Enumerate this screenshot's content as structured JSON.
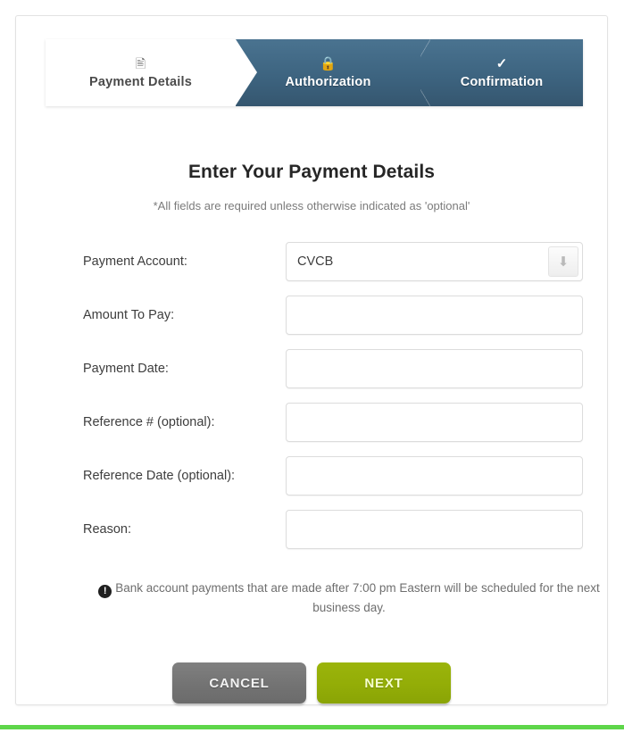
{
  "stepper": {
    "steps": [
      {
        "label": "Payment Details",
        "icon": "document-icon",
        "state": "active"
      },
      {
        "label": "Authorization",
        "icon": "lock-icon",
        "state": "inactive"
      },
      {
        "label": "Confirmation",
        "icon": "check-icon",
        "state": "inactive"
      }
    ]
  },
  "form": {
    "title": "Enter Your Payment Details",
    "subtitle": "*All fields are required unless otherwise indicated as 'optional'",
    "fields": [
      {
        "label": "Payment Account:",
        "type": "select",
        "value": "CVCB",
        "placeholder": "",
        "options": [
          "CVCB"
        ]
      },
      {
        "label": "Amount To Pay:",
        "type": "text",
        "value": "",
        "placeholder": ""
      },
      {
        "label": "Payment Date:",
        "type": "text",
        "value": "",
        "placeholder": ""
      },
      {
        "label": "Reference # (optional):",
        "type": "text",
        "value": "",
        "placeholder": ""
      },
      {
        "label": "Reference Date (optional):",
        "type": "text",
        "value": "",
        "placeholder": ""
      },
      {
        "label": "Reason:",
        "type": "text",
        "value": "",
        "placeholder": ""
      }
    ]
  },
  "notice": {
    "icon": "exclamation-circle-icon",
    "text": "Bank account payments that are made after 7:00 pm Eastern will be scheduled for the next business day."
  },
  "actions": {
    "cancel_label": "CANCEL",
    "next_label": "NEXT"
  },
  "colors": {
    "step_inactive": "#3d6480",
    "next_button": "#93ad07",
    "cancel_button": "#737373",
    "bottom_bar": "#5ed64a"
  }
}
